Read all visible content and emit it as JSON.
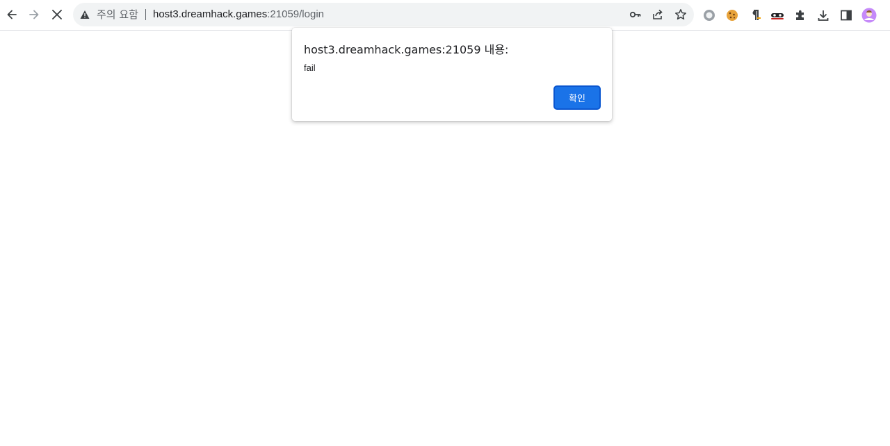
{
  "browser": {
    "nav": {
      "back_icon": "arrow-left-icon",
      "forward_icon": "arrow-right-icon",
      "stop_icon": "close-icon"
    },
    "omnibox": {
      "security_icon": "warning-triangle-icon",
      "security_label": "주의 요함",
      "url_host": "host3.dreamhack.games",
      "url_rest": ":21059/login"
    },
    "actions": [
      "key-icon",
      "share-icon",
      "star-icon"
    ],
    "extensions": [
      "circle-extension-icon",
      "cookie-icon",
      "pilcrow-icon",
      "mask-icon",
      "puzzle-icon",
      "download-icon",
      "sidepanel-icon",
      "profile-avatar-icon"
    ]
  },
  "dialog": {
    "title": "host3.dreamhack.games:21059 내용:",
    "message": "fail",
    "ok_label": "확인"
  },
  "colors": {
    "accent": "#1a73e8",
    "warning": "#5f6368"
  }
}
